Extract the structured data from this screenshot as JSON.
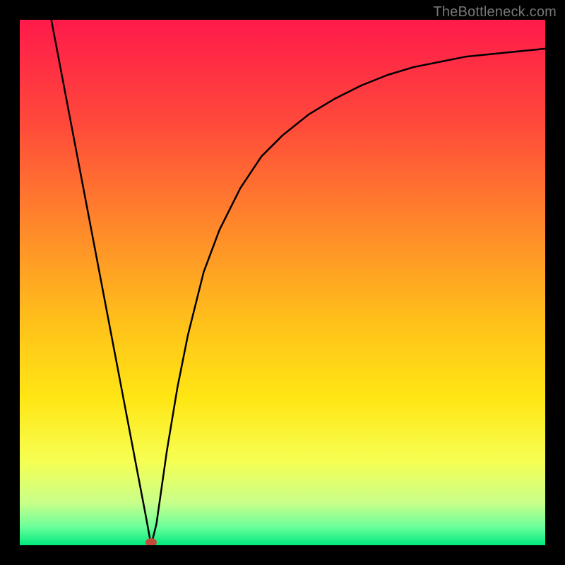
{
  "attribution": "TheBottleneck.com",
  "chart_data": {
    "type": "line",
    "title": "",
    "xlabel": "",
    "ylabel": "",
    "xlim": [
      0,
      100
    ],
    "ylim": [
      0,
      100
    ],
    "grid": false,
    "series": [
      {
        "name": "bottleneck_curve",
        "x": [
          6,
          10,
          14,
          18,
          22,
          24,
          25,
          26,
          27,
          28,
          30,
          32,
          35,
          38,
          42,
          46,
          50,
          55,
          60,
          65,
          70,
          75,
          80,
          85,
          90,
          95,
          100
        ],
        "values": [
          100,
          79,
          58,
          37,
          16,
          5.5,
          0,
          4,
          11,
          18,
          30,
          40,
          52,
          60,
          68,
          74,
          78,
          82,
          85,
          87.5,
          89.5,
          91,
          92,
          93,
          93.5,
          94,
          94.5
        ]
      }
    ],
    "marker": {
      "x": 25,
      "y": 0,
      "color": "#c44a3a"
    },
    "background_gradient": {
      "stops": [
        {
          "offset": 0.0,
          "color": "#ff1a4b"
        },
        {
          "offset": 0.2,
          "color": "#ff4a3a"
        },
        {
          "offset": 0.4,
          "color": "#ff8a2a"
        },
        {
          "offset": 0.58,
          "color": "#ffc21a"
        },
        {
          "offset": 0.72,
          "color": "#ffe614"
        },
        {
          "offset": 0.84,
          "color": "#f6ff52"
        },
        {
          "offset": 0.92,
          "color": "#c8ff8a"
        },
        {
          "offset": 0.965,
          "color": "#6bff9a"
        },
        {
          "offset": 1.0,
          "color": "#00e97e"
        }
      ]
    }
  }
}
